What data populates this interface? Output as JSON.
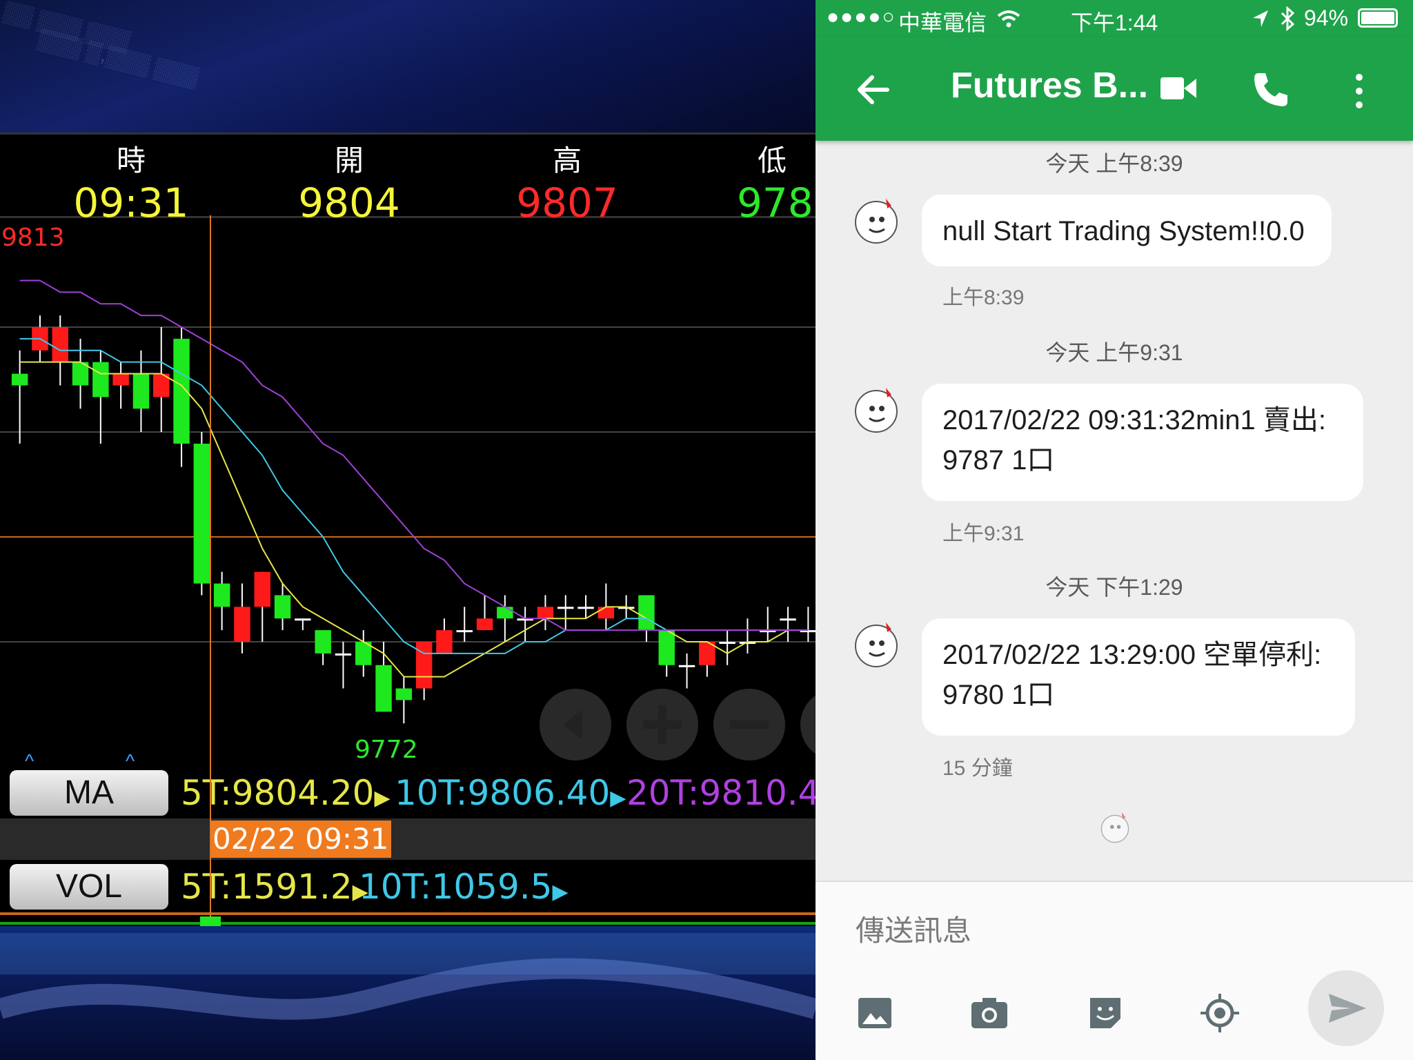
{
  "quote": {
    "time_label": "時",
    "time_value": "09:31",
    "open_label": "開",
    "open_value": "9804",
    "high_label": "高",
    "high_value": "9807",
    "low_label": "低",
    "low_value": "978"
  },
  "chart": {
    "high_marker": "9813",
    "low_marker": "9772"
  },
  "chart_data": {
    "type": "candlestick",
    "ylim": [
      9770,
      9815
    ],
    "candles": [
      {
        "o": 9802,
        "c": 9801,
        "h": 9804,
        "l": 9796
      },
      {
        "o": 9804,
        "c": 9806,
        "h": 9807,
        "l": 9803
      },
      {
        "o": 9803,
        "c": 9806,
        "h": 9807,
        "l": 9801
      },
      {
        "o": 9803,
        "c": 9801,
        "h": 9805,
        "l": 9799
      },
      {
        "o": 9803,
        "c": 9800,
        "h": 9804,
        "l": 9796
      },
      {
        "o": 9801,
        "c": 9802,
        "h": 9803,
        "l": 9799
      },
      {
        "o": 9802,
        "c": 9799,
        "h": 9804,
        "l": 9797
      },
      {
        "o": 9800,
        "c": 9802,
        "h": 9806,
        "l": 9797
      },
      {
        "o": 9805,
        "c": 9796,
        "h": 9806,
        "l": 9794
      },
      {
        "o": 9796,
        "c": 9784,
        "h": 9797,
        "l": 9783
      },
      {
        "o": 9784,
        "c": 9782,
        "h": 9785,
        "l": 9780
      },
      {
        "o": 9779,
        "c": 9782,
        "h": 9784,
        "l": 9778
      },
      {
        "o": 9782,
        "c": 9785,
        "h": 9785,
        "l": 9779
      },
      {
        "o": 9783,
        "c": 9781,
        "h": 9784,
        "l": 9780
      },
      {
        "o": 9781,
        "c": 9781,
        "h": 9781,
        "l": 9780
      },
      {
        "o": 9780,
        "c": 9778,
        "h": 9780,
        "l": 9777
      },
      {
        "o": 9778,
        "c": 9778,
        "h": 9779,
        "l": 9775
      },
      {
        "o": 9779,
        "c": 9777,
        "h": 9780,
        "l": 9776
      },
      {
        "o": 9777,
        "c": 9773,
        "h": 9779,
        "l": 9773
      },
      {
        "o": 9775,
        "c": 9774,
        "h": 9776,
        "l": 9772
      },
      {
        "o": 9775,
        "c": 9779,
        "h": 9779,
        "l": 9774
      },
      {
        "o": 9778,
        "c": 9780,
        "h": 9781,
        "l": 9778
      },
      {
        "o": 9780,
        "c": 9780,
        "h": 9782,
        "l": 9779
      },
      {
        "o": 9780,
        "c": 9781,
        "h": 9783,
        "l": 9780
      },
      {
        "o": 9782,
        "c": 9781,
        "h": 9783,
        "l": 9779
      },
      {
        "o": 9781,
        "c": 9781,
        "h": 9782,
        "l": 9779
      },
      {
        "o": 9781,
        "c": 9782,
        "h": 9783,
        "l": 9780
      },
      {
        "o": 9782,
        "c": 9782,
        "h": 9783,
        "l": 9780
      },
      {
        "o": 9782,
        "c": 9782,
        "h": 9783,
        "l": 9781
      },
      {
        "o": 9781,
        "c": 9782,
        "h": 9784,
        "l": 9780
      },
      {
        "o": 9782,
        "c": 9782,
        "h": 9783,
        "l": 9781
      },
      {
        "o": 9783,
        "c": 9780,
        "h": 9783,
        "l": 9779
      },
      {
        "o": 9780,
        "c": 9777,
        "h": 9780,
        "l": 9776
      },
      {
        "o": 9777,
        "c": 9777,
        "h": 9778,
        "l": 9775
      },
      {
        "o": 9777,
        "c": 9779,
        "h": 9779,
        "l": 9776
      },
      {
        "o": 9779,
        "c": 9779,
        "h": 9780,
        "l": 9777
      },
      {
        "o": 9779,
        "c": 9779,
        "h": 9781,
        "l": 9778
      },
      {
        "o": 9780,
        "c": 9780,
        "h": 9782,
        "l": 9779
      },
      {
        "o": 9781,
        "c": 9781,
        "h": 9782,
        "l": 9779
      },
      {
        "o": 9780,
        "c": 9780,
        "h": 9782,
        "l": 9779
      }
    ],
    "ma_lines": [
      {
        "name": "5T",
        "color": "#e6e64a",
        "values": [
          9803,
          9803,
          9803,
          9803,
          9802,
          9802,
          9802,
          9802,
          9801,
          9799,
          9795,
          9791,
          9787,
          9784,
          9782,
          9781,
          9780,
          9779,
          9778,
          9776,
          9776,
          9776,
          9777,
          9778,
          9779,
          9780,
          9781,
          9781,
          9781,
          9782,
          9782,
          9781,
          9780,
          9779,
          9779,
          9778,
          9779,
          9779,
          9780,
          9780
        ]
      },
      {
        "name": "10T",
        "color": "#3fc8e8",
        "values": [
          9805,
          9805,
          9804,
          9804,
          9804,
          9803,
          9803,
          9803,
          9802,
          9801,
          9799,
          9797,
          9795,
          9792,
          9790,
          9788,
          9785,
          9783,
          9781,
          9779,
          9778,
          9778,
          9778,
          9778,
          9778,
          9779,
          9779,
          9780,
          9780,
          9780,
          9781,
          9781,
          9780,
          9780,
          9780,
          9780,
          9780,
          9780,
          9780,
          9780
        ]
      },
      {
        "name": "20T",
        "color": "#a040d8",
        "values": [
          9810,
          9810,
          9809,
          9809,
          9808,
          9808,
          9807,
          9807,
          9806,
          9805,
          9804,
          9803,
          9801,
          9800,
          9798,
          9796,
          9795,
          9793,
          9791,
          9789,
          9787,
          9786,
          9784,
          9783,
          9782,
          9781,
          9781,
          9780,
          9780,
          9780,
          9780,
          9780,
          9780,
          9780,
          9780,
          9780,
          9780,
          9780,
          9780,
          9780
        ]
      }
    ]
  },
  "ma": {
    "button_label": "MA",
    "ma5": "5T:9804.20",
    "ma10": "10T:9806.40",
    "ma20": "20T:9810.4"
  },
  "time_label": "02/22 09:31",
  "vol": {
    "button_label": "VOL",
    "vol5": "5T:1591.2",
    "vol10": "10T:1059.5"
  },
  "colors": {
    "up": "#ff1a1a",
    "down": "#1ee81e",
    "ma5": "#e6e64a",
    "ma10": "#3fc8e8",
    "ma20": "#a040d8",
    "app_green": "#1ea34a"
  },
  "status_bar": {
    "signal": "●●●●○",
    "carrier": "中華電信",
    "time": "下午1:44",
    "battery": "94%"
  },
  "app_bar": {
    "title": "Futures B..."
  },
  "messages": [
    {
      "date": "今天 上午8:39",
      "text": "null Start Trading System!!0.0",
      "time": "上午8:39"
    },
    {
      "date": "今天 上午9:31",
      "text": "2017/02/22 09:31:32min1 賣出: 9787 1口",
      "time": "上午9:31"
    },
    {
      "date": "今天 下午1:29",
      "text": "2017/02/22 13:29:00 空單停利: 9780 1口",
      "time": "15 分鐘"
    }
  ],
  "composer": {
    "placeholder": "傳送訊息"
  }
}
